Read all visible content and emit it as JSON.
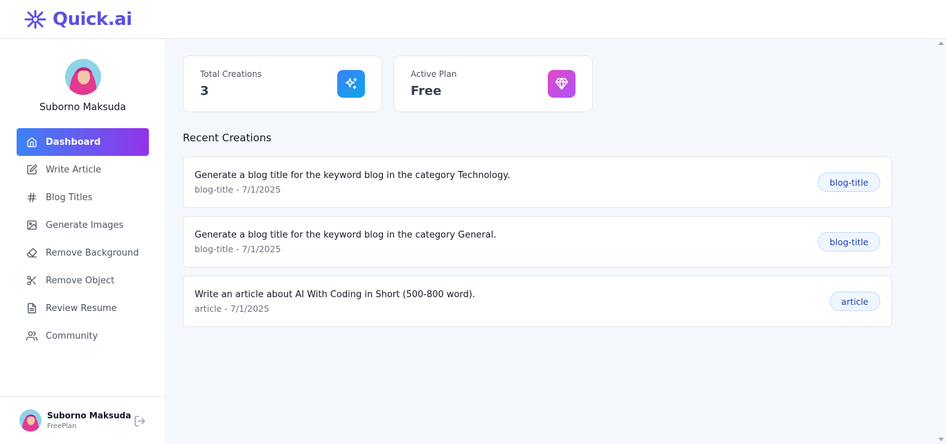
{
  "brand": {
    "name": "Quick.ai",
    "color": "#5b4fe0"
  },
  "user": {
    "name": "Suborno Maksuda",
    "plan_label": "FreePlan"
  },
  "nav": {
    "items": [
      {
        "label": "Dashboard",
        "icon": "home-icon",
        "active": true
      },
      {
        "label": "Write Article",
        "icon": "edit-icon"
      },
      {
        "label": "Blog Titles",
        "icon": "hash-icon"
      },
      {
        "label": "Generate Images",
        "icon": "image-icon"
      },
      {
        "label": "Remove Background",
        "icon": "eraser-icon"
      },
      {
        "label": "Remove Object",
        "icon": "scissors-icon"
      },
      {
        "label": "Review Resume",
        "icon": "file-text-icon"
      },
      {
        "label": "Community",
        "icon": "users-icon"
      }
    ]
  },
  "stats": {
    "total_creations": {
      "label": "Total Creations",
      "value": "3",
      "icon": "sparkles-icon",
      "color": "#2196f3"
    },
    "active_plan": {
      "label": "Active Plan",
      "value": "Free",
      "icon": "gem-icon",
      "color": "#d946ef"
    }
  },
  "recent": {
    "title": "Recent Creations",
    "items": [
      {
        "prompt": "Generate a blog title for the keyword blog in the category Technology.",
        "meta": "blog-title - 7/1/2025",
        "tag": "blog-title"
      },
      {
        "prompt": "Generate a blog title for the keyword blog in the category General.",
        "meta": "blog-title - 7/1/2025",
        "tag": "blog-title"
      },
      {
        "prompt": "Write an article about AI With Coding in Short (500-800 word).",
        "meta": "article - 7/1/2025",
        "tag": "article"
      }
    ]
  }
}
